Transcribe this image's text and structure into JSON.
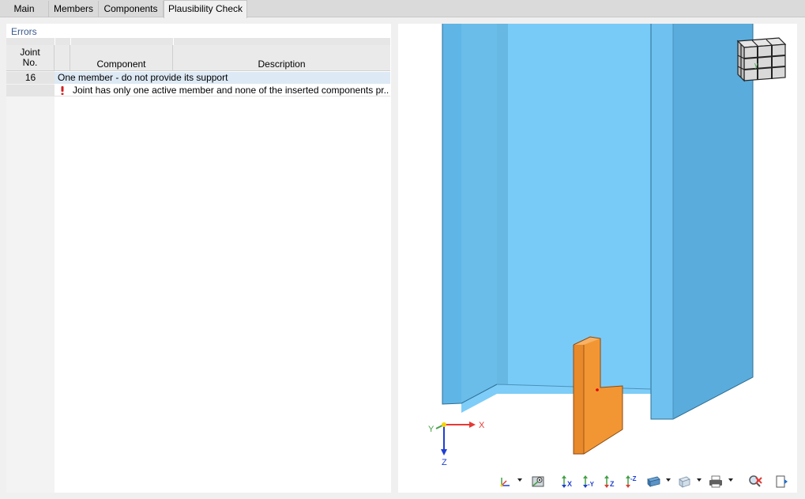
{
  "tabs": [
    {
      "label": "Main",
      "active": false
    },
    {
      "label": "Members",
      "active": false
    },
    {
      "label": "Components",
      "active": false
    },
    {
      "label": "Plausibility Check",
      "active": true
    }
  ],
  "errors_panel": {
    "title": "Errors",
    "columns": {
      "joint_no": "Joint\nNo.",
      "component": "Component",
      "description": "Description"
    },
    "groups": [
      {
        "joint_no": "16",
        "title": "One member - do not provide its support",
        "rows": [
          {
            "icon": "error-icon",
            "message": "Joint has only one active member and none of the inserted components pr..."
          }
        ]
      }
    ]
  },
  "view": {
    "axes": {
      "x": "X",
      "y": "Y",
      "z": "Z"
    },
    "colors": {
      "member_light": "#79cbf7",
      "member_mid": "#6bbde9",
      "member_dark": "#4fa4d6",
      "plate_front": "#f39a37",
      "plate_side": "#d9832a",
      "axis_x": "#e53935",
      "axis_y": "#43a047",
      "axis_z": "#1e3fd3"
    }
  },
  "toolbar": {
    "buttons": [
      "axis-view-icon",
      "view-options-icon",
      "view-x-icon",
      "view-minus-y-icon",
      "view-z-icon",
      "view-minus-z-icon",
      "render-mode-icon",
      "transparency-icon",
      "print-icon",
      "reset-view-icon",
      "export-icon"
    ],
    "labels": {
      "x": "X",
      "minus_y": "-Y",
      "z": "Z",
      "minus_z": "-Z"
    }
  }
}
